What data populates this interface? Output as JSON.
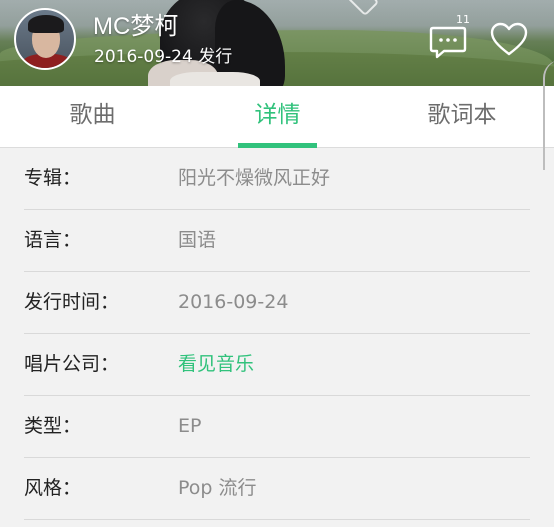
{
  "header": {
    "artist_name": "MC梦柯",
    "release_text": "2016-09-24 发行",
    "comment_count": "11",
    "icons": {
      "comment": "comment-icon",
      "like": "heart-icon"
    }
  },
  "tabs": [
    {
      "label": "歌曲",
      "active": false
    },
    {
      "label": "详情",
      "active": true
    },
    {
      "label": "歌词本",
      "active": false
    }
  ],
  "details": [
    {
      "label": "专辑：",
      "value": "阳光不燥微风正好"
    },
    {
      "label": "语言：",
      "value": "国语"
    },
    {
      "label": "发行时间：",
      "value": "2016-09-24"
    },
    {
      "label": "唱片公司：",
      "value": "看见音乐"
    },
    {
      "label": "类型：",
      "value": "EP"
    },
    {
      "label": "风格：",
      "value": "Pop 流行"
    }
  ],
  "colors": {
    "accent": "#31c27c",
    "label": "#222222",
    "value": "#8c8c8c",
    "background": "#f2f2f2"
  }
}
